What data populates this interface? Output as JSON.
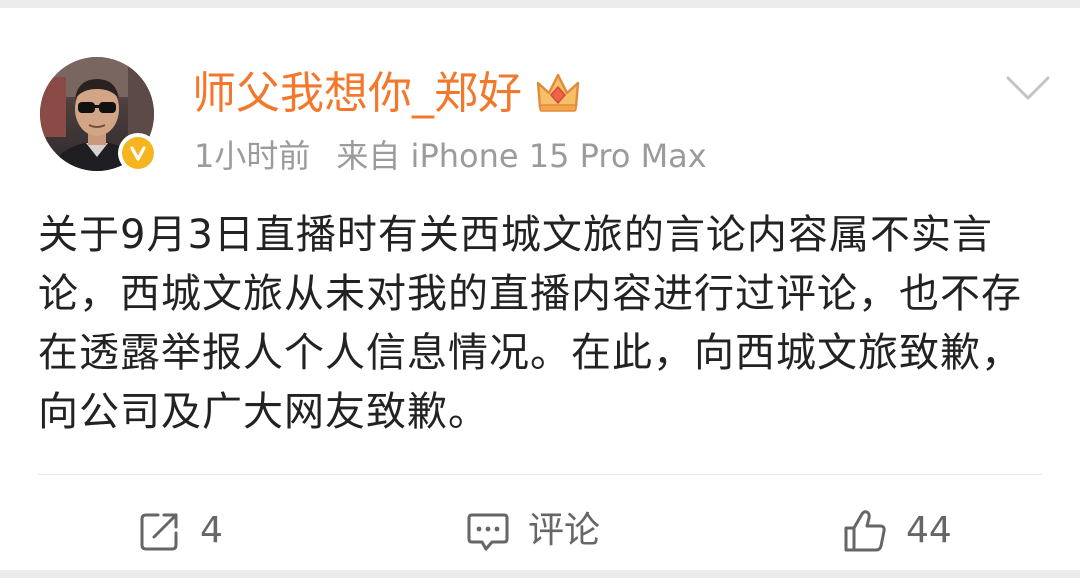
{
  "post": {
    "author": {
      "name": "师父我想你_郑好",
      "verified_badge_color": "#f6b51e",
      "name_color": "#f3782c",
      "vip_icon": "crown-icon"
    },
    "meta": {
      "time": "1小时前",
      "source": "来自 iPhone 15 Pro Max"
    },
    "text": "关于9月3日直播时有关西城文旅的言论内容属不实言论，西城文旅从未对我的直播内容进行过评论，也不存在透露举报人个人信息情况。在此，向西城文旅致歉，向公司及广大网友致歉。",
    "menu_icon": "chevron-down-icon"
  },
  "actions": {
    "repost": {
      "icon": "share-icon",
      "count": "4"
    },
    "comment": {
      "icon": "comment-icon",
      "label": "评论"
    },
    "like": {
      "icon": "thumbs-up-icon",
      "count": "44"
    }
  }
}
